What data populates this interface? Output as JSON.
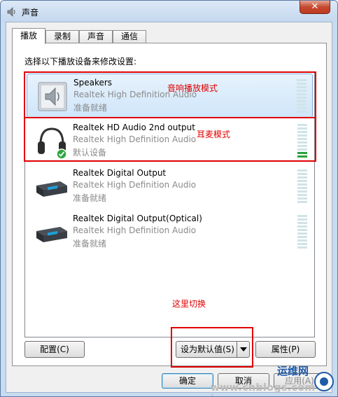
{
  "window": {
    "title": "声音",
    "close_glyph": "✕"
  },
  "tabs": [
    {
      "label": "播放",
      "active": true
    },
    {
      "label": "录制",
      "active": false
    },
    {
      "label": "声音",
      "active": false
    },
    {
      "label": "通信",
      "active": false
    }
  ],
  "instruction": "选择以下播放设备来修改设置:",
  "devices": [
    {
      "name": "Speakers",
      "driver": "Realtek High Definition Audio",
      "status": "准备就绪",
      "icon": "speaker-icon",
      "selected": true,
      "meter_level": 0
    },
    {
      "name": "Realtek HD Audio 2nd output",
      "driver": "Realtek High Definition Audio",
      "status": "默认设备",
      "icon": "headphones-icon",
      "selected": false,
      "default": true,
      "meter_level": 0.2
    },
    {
      "name": "Realtek Digital Output",
      "driver": "Realtek High Definition Audio",
      "status": "准备就绪",
      "icon": "digital-output-icon",
      "selected": false,
      "meter_level": 0
    },
    {
      "name": "Realtek Digital Output(Optical)",
      "driver": "Realtek High Definition Audio",
      "status": "准备就绪",
      "icon": "optical-output-icon",
      "selected": false,
      "meter_level": 0
    }
  ],
  "annotations": {
    "speaker_mode": "音响播放模式",
    "headphone_mode": "耳麦模式",
    "switch_here": "这里切换"
  },
  "buttons": {
    "configure": "配置(C)",
    "set_default": "设为默认值(S)",
    "properties": "属性(P)",
    "ok": "确定",
    "cancel": "取消",
    "apply": "应用(A)"
  },
  "watermark": {
    "title": "运维网",
    "url": "www.cnblogs.com  iyunv.com"
  },
  "colors": {
    "annotation_red": "#e00000",
    "meter_active": "#2aa33a",
    "selection": "#cfe6fa"
  }
}
